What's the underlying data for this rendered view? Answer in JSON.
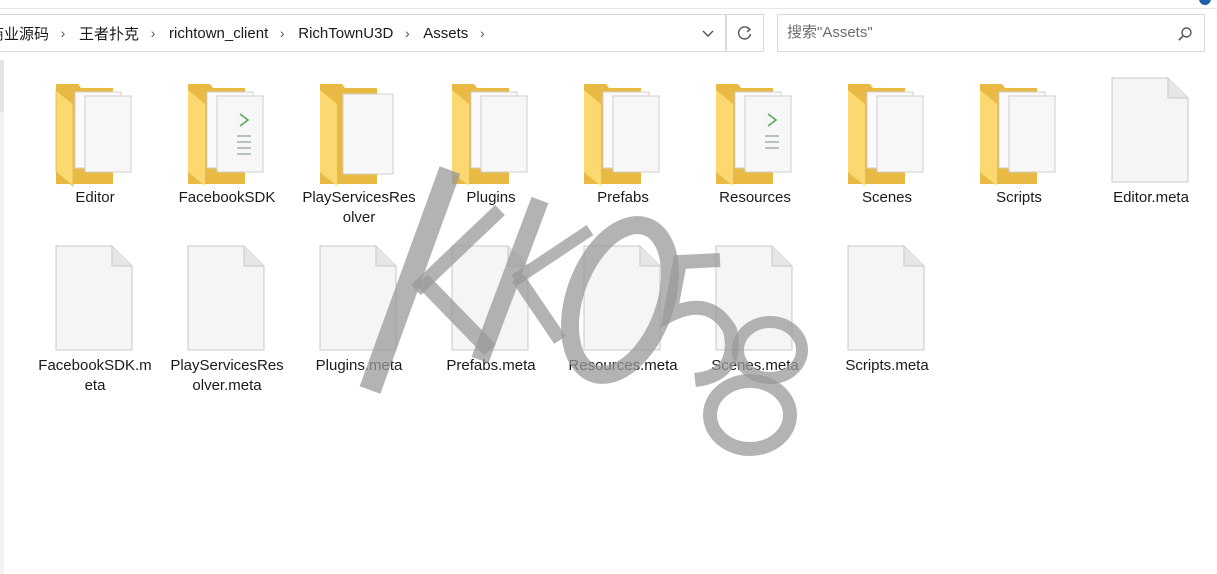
{
  "breadcrumb": [
    "商业源码",
    "王者扑克",
    "richtown_client",
    "RichTownU3D",
    "Assets"
  ],
  "search": {
    "placeholder": "搜索\"Assets\""
  },
  "folders": [
    {
      "name": "Editor",
      "variant": "docs"
    },
    {
      "name": "FacebookSDK",
      "variant": "code"
    },
    {
      "name": "PlayServicesResolver",
      "variant": "single"
    },
    {
      "name": "Plugins",
      "variant": "docs"
    },
    {
      "name": "Prefabs",
      "variant": "docs"
    },
    {
      "name": "Resources",
      "variant": "code"
    },
    {
      "name": "Scenes",
      "variant": "docs"
    },
    {
      "name": "Scripts",
      "variant": "docs"
    }
  ],
  "files_row1": [
    {
      "name": "Editor.meta"
    }
  ],
  "files_row2": [
    {
      "name": "FacebookSDK.meta"
    },
    {
      "name": "PlayServicesResolver.meta"
    },
    {
      "name": "Plugins.meta"
    },
    {
      "name": "Prefabs.meta"
    },
    {
      "name": "Resources.meta"
    },
    {
      "name": "Scenes.meta"
    },
    {
      "name": "Scripts.meta"
    }
  ],
  "watermark": {
    "text": "KK058",
    "color": "#9a9a9a"
  },
  "colors": {
    "folder_front": "#fbd970",
    "folder_back": "#e8b943",
    "file_bg": "#f5f5f5",
    "file_border": "#c8c8c8"
  },
  "icons": {
    "dropdown": "chevron-down-icon",
    "refresh": "refresh-icon",
    "search": "search-icon"
  }
}
